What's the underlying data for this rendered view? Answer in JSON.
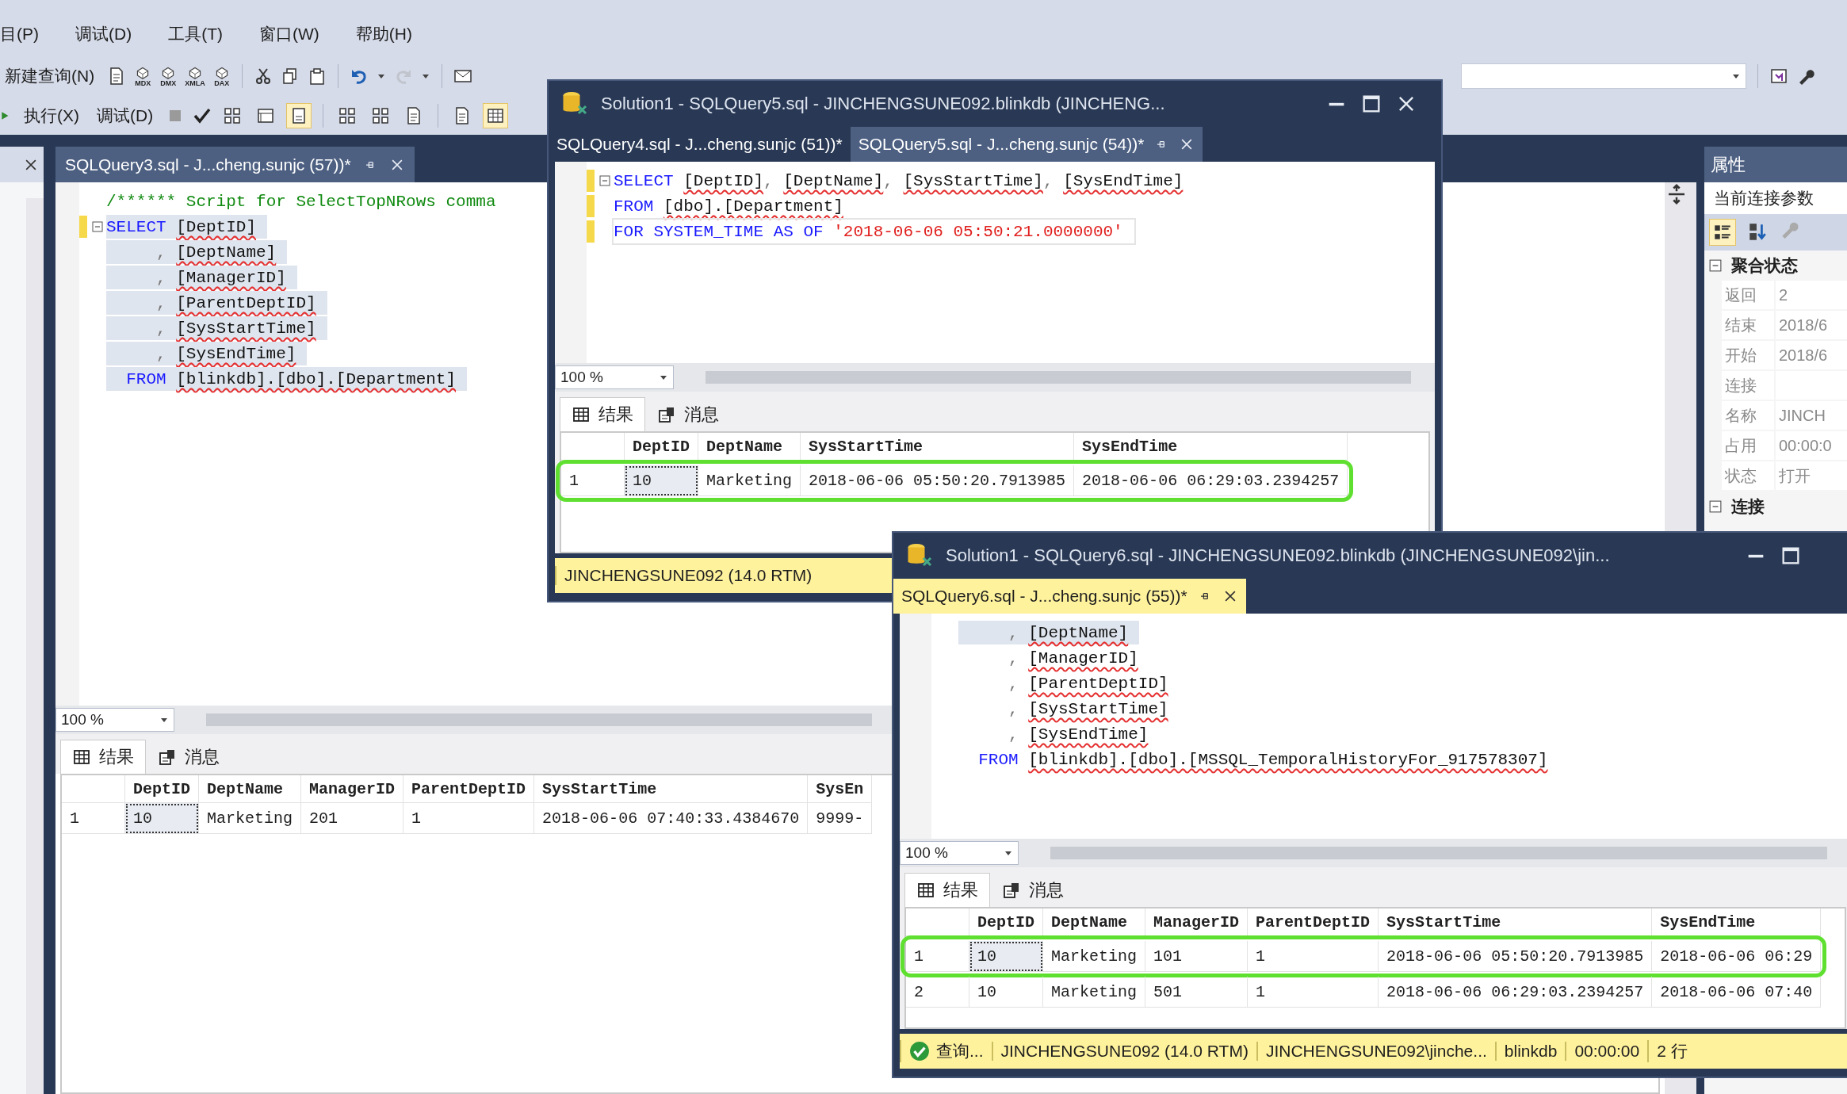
{
  "menu": [
    "目(P)",
    "调试(D)",
    "工具(T)",
    "窗口(W)",
    "帮助(H)"
  ],
  "toolbar1": {
    "new_query": "新建查询(N)",
    "query_types": [
      "MDX",
      "DMX",
      "XMLA",
      "DAX"
    ]
  },
  "toolbar2": {
    "execute": "执行(X)",
    "debug": "调试(D)",
    "toggles": [
      {
        "on": false
      },
      {
        "on": false
      },
      {
        "on": true
      },
      {
        "on": false
      },
      {
        "on": false
      },
      {
        "on": false
      },
      {
        "on": false
      },
      {
        "on": true
      }
    ]
  },
  "editor": {
    "tab": "SQLQuery3.sql - J...cheng.sunjc (57))*",
    "lines": [
      {
        "kind": "free",
        "fold": false,
        "changed": false,
        "selected": false,
        "tokens": [
          {
            "kind": "comment",
            "text": "/****** Script for SelectTopNRows comma"
          }
        ]
      },
      {
        "kind": "clause",
        "fold": true,
        "changed": true,
        "selected": true,
        "tokens": [
          {
            "kind": "keyword",
            "text": "SELECT"
          },
          {
            "kind": "ident",
            "text": "[DeptID]"
          }
        ]
      },
      {
        "kind": "clause",
        "fold": false,
        "changed": false,
        "selected": true,
        "tokens": [
          {
            "kind": "punct",
            "text": ","
          },
          {
            "kind": "ident",
            "text": "[DeptName]"
          }
        ]
      },
      {
        "kind": "clause",
        "fold": false,
        "changed": false,
        "selected": true,
        "tokens": [
          {
            "kind": "punct",
            "text": ","
          },
          {
            "kind": "ident",
            "text": "[ManagerID]"
          }
        ]
      },
      {
        "kind": "clause",
        "fold": false,
        "changed": false,
        "selected": true,
        "tokens": [
          {
            "kind": "punct",
            "text": ","
          },
          {
            "kind": "ident",
            "text": "[ParentDeptID]"
          }
        ]
      },
      {
        "kind": "clause",
        "fold": false,
        "changed": false,
        "selected": true,
        "tokens": [
          {
            "kind": "punct",
            "text": ","
          },
          {
            "kind": "ident",
            "text": "[SysStartTime]"
          }
        ]
      },
      {
        "kind": "clause",
        "fold": false,
        "changed": false,
        "selected": true,
        "tokens": [
          {
            "kind": "punct",
            "text": ","
          },
          {
            "kind": "ident",
            "text": "[SysEndTime]"
          }
        ]
      },
      {
        "kind": "clause",
        "fold": false,
        "changed": false,
        "selected": true,
        "tokens": [
          {
            "kind": "keyword",
            "text": "FROM"
          },
          {
            "kind": "ident",
            "text": "[blinkdb].[dbo].[Department]"
          }
        ]
      }
    ],
    "zoom": "100 %",
    "result_tabs": [
      {
        "label": "结果",
        "selected": true
      },
      {
        "label": "消息",
        "selected": false
      }
    ],
    "grid": {
      "columns": [
        "DeptID",
        "DeptName",
        "ManagerID",
        "ParentDeptID",
        "SysStartTime",
        "SysEn"
      ],
      "rows": [
        {
          "number": "1",
          "current": true,
          "highlighted": false,
          "cells": [
            "10",
            "Marketing",
            "201",
            "1",
            "2018-06-06 07:40:33.4384670",
            "9999-"
          ]
        }
      ]
    }
  },
  "properties": {
    "title": "属性",
    "object": "当前连接参数",
    "toolbar": [
      {
        "on": true
      },
      {
        "on": false
      }
    ],
    "sections": [
      {
        "name": "聚合状态",
        "expanded": true,
        "rows": [
          {
            "name": "返回",
            "value": "2"
          },
          {
            "name": "结束",
            "value": "2018/6"
          },
          {
            "name": "开始",
            "value": "2018/6"
          },
          {
            "name": "连接"
          },
          {
            "name": "名称",
            "value": "JINCH"
          },
          {
            "name": "占用",
            "value": "00:00:0"
          },
          {
            "name": "状态",
            "value": "打开"
          }
        ]
      },
      {
        "name": "连接",
        "expanded": true
      }
    ]
  },
  "windows": [
    {
      "title": "Solution1 - SQLQuery5.sql - JINCHENGSUNE092.blinkdb (JINCHENG...",
      "closable": true,
      "active": false,
      "tabs": [
        {
          "label": "SQLQuery4.sql - J...cheng.sunjc (51))*",
          "selected": false
        },
        {
          "label": "SQLQuery5.sql - J...cheng.sunjc (54))*",
          "selected": true
        }
      ],
      "lines": [
        {
          "kind": "free",
          "fold": true,
          "changed": true,
          "selected": false,
          "tokens": [
            {
              "kind": "keyword",
              "text": "SELECT"
            },
            {
              "kind": "ident",
              "text": "[DeptID]"
            },
            {
              "kind": "punct",
              "text": ","
            },
            {
              "kind": "ident",
              "text": "[DeptName]"
            },
            {
              "kind": "punct",
              "text": ","
            },
            {
              "kind": "ident",
              "text": "[SysStartTime]"
            },
            {
              "kind": "punct",
              "text": ","
            },
            {
              "kind": "ident",
              "text": "[SysEndTime]"
            }
          ]
        },
        {
          "kind": "free",
          "fold": false,
          "changed": true,
          "selected": false,
          "tokens": [
            {
              "kind": "keyword",
              "text": "FROM"
            },
            {
              "kind": "ident",
              "text": "[dbo].[Department]"
            }
          ]
        },
        {
          "kind": "free",
          "fold": false,
          "changed": true,
          "selected": false,
          "current": true,
          "tokens": [
            {
              "kind": "keyword",
              "text": "FOR SYSTEM_TIME AS OF"
            },
            {
              "kind": "string",
              "text": "'2018-06-06 05:50:21.0000000'"
            }
          ]
        }
      ],
      "zoom": "100 %",
      "result_tabs": [
        {
          "label": "结果",
          "selected": true
        },
        {
          "label": "消息",
          "selected": false
        }
      ],
      "grid": {
        "columns": [
          "DeptID",
          "DeptName",
          "SysStartTime",
          "SysEndTime"
        ],
        "rows": [
          {
            "number": "1",
            "current": true,
            "highlighted": true,
            "cells": [
              "10",
              "Marketing",
              "2018-06-06 05:50:20.7913985",
              "2018-06-06 06:29:03.2394257"
            ]
          }
        ]
      },
      "status": [
        {
          "kind": "text",
          "text": "JINCHENGSUNE092 (14.0 RTM)"
        }
      ]
    },
    {
      "title": "Solution1 - SQLQuery6.sql - JINCHENGSUNE092.blinkdb (JINCHENGSUNE092\\jin...",
      "closable": false,
      "active": true,
      "tabs": [
        {
          "label": "SQLQuery6.sql - J...cheng.sunjc (55))*",
          "selected": true
        }
      ],
      "lines": [
        {
          "kind": "clause",
          "fold": false,
          "changed": false,
          "selected": true,
          "tokens": [
            {
              "kind": "punct",
              "text": ","
            },
            {
              "kind": "ident",
              "text": "[DeptName]"
            }
          ]
        },
        {
          "kind": "clause",
          "fold": false,
          "changed": false,
          "selected": false,
          "tokens": [
            {
              "kind": "punct",
              "text": ","
            },
            {
              "kind": "ident",
              "text": "[ManagerID]"
            }
          ]
        },
        {
          "kind": "clause",
          "fold": false,
          "changed": false,
          "selected": false,
          "tokens": [
            {
              "kind": "punct",
              "text": ","
            },
            {
              "kind": "ident",
              "text": "[ParentDeptID]"
            }
          ]
        },
        {
          "kind": "clause",
          "fold": false,
          "changed": false,
          "selected": false,
          "tokens": [
            {
              "kind": "punct",
              "text": ","
            },
            {
              "kind": "ident",
              "text": "[SysStartTime]"
            }
          ]
        },
        {
          "kind": "clause",
          "fold": false,
          "changed": false,
          "selected": false,
          "tokens": [
            {
              "kind": "punct",
              "text": ","
            },
            {
              "kind": "ident",
              "text": "[SysEndTime]"
            }
          ]
        },
        {
          "kind": "clause",
          "fold": false,
          "changed": false,
          "selected": false,
          "tokens": [
            {
              "kind": "keyword",
              "text": "FROM"
            },
            {
              "kind": "ident",
              "text": "[blinkdb].[dbo].[MSSQL_TemporalHistoryFor_917578307]"
            }
          ]
        }
      ],
      "zoom": "100 %",
      "result_tabs": [
        {
          "label": "结果",
          "selected": true
        },
        {
          "label": "消息",
          "selected": false
        }
      ],
      "grid": {
        "columns": [
          "DeptID",
          "DeptName",
          "ManagerID",
          "ParentDeptID",
          "SysStartTime",
          "SysEndTime"
        ],
        "rows": [
          {
            "number": "1",
            "current": true,
            "highlighted": true,
            "cells": [
              "10",
              "Marketing",
              "101",
              "1",
              "2018-06-06 05:50:20.7913985",
              "2018-06-06 06:29"
            ]
          },
          {
            "number": "2",
            "current": false,
            "highlighted": false,
            "cells": [
              "10",
              "Marketing",
              "501",
              "1",
              "2018-06-06 06:29:03.2394257",
              "2018-06-06 07:40"
            ]
          }
        ]
      },
      "status": [
        {
          "kind": "ok",
          "text": "查询..."
        },
        {
          "kind": "text",
          "text": "JINCHENGSUNE092 (14.0 RTM)"
        },
        {
          "kind": "text",
          "text": "JINCHENGSUNE092\\jinche..."
        },
        {
          "kind": "text",
          "text": "blinkdb"
        },
        {
          "kind": "text",
          "text": "00:00:00"
        },
        {
          "kind": "text",
          "text": "2 行"
        }
      ]
    }
  ]
}
